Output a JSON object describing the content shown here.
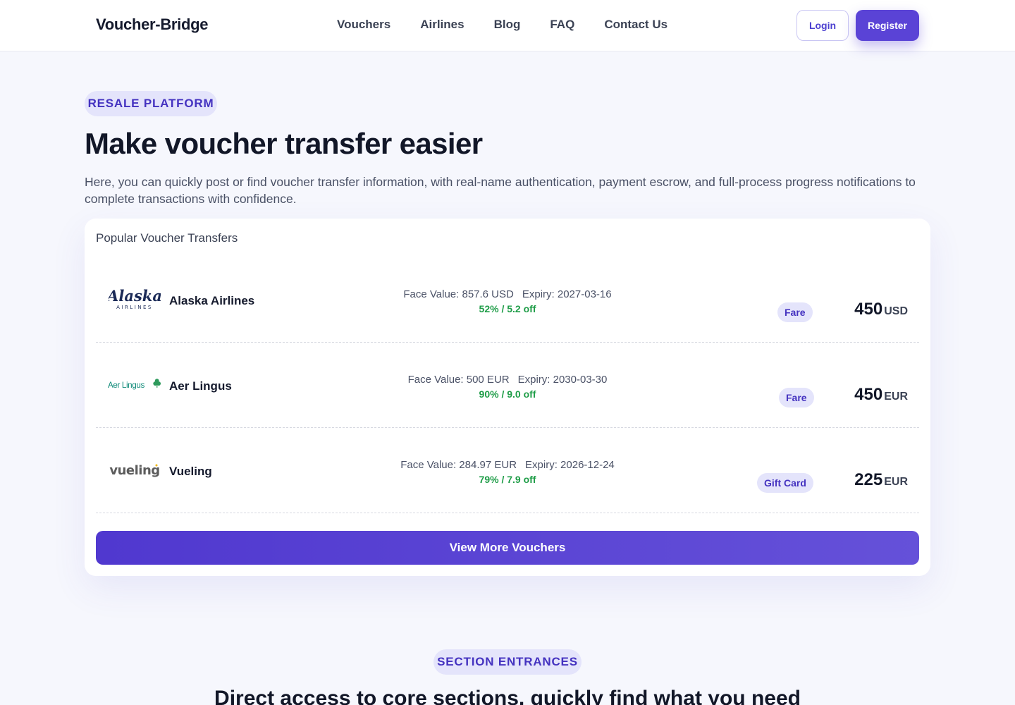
{
  "header": {
    "brand": "Voucher-Bridge",
    "nav": [
      "Vouchers",
      "Airlines",
      "Blog",
      "FAQ",
      "Contact Us"
    ],
    "login_label": "Login",
    "register_label": "Register"
  },
  "hero": {
    "pill": "RESALE PLATFORM",
    "title": "Make voucher transfer easier",
    "description": "Here, you can quickly post or find voucher transfer information, with real-name authentication, payment escrow, and full-process progress notifications to complete transactions with confidence."
  },
  "popular": {
    "title": "Popular Voucher Transfers",
    "rows": [
      {
        "airline": "Alaska Airlines",
        "logo_text": "Alaska",
        "logo_sub": "AIRLINES",
        "face_value": "Face Value: 857.6 USD",
        "expiry": "Expiry: 2027-03-16",
        "discount": "52% / 5.2 off",
        "badge": "Fare",
        "price": "450",
        "currency": "USD"
      },
      {
        "airline": "Aer Lingus",
        "logo_text": "Aer Lingus",
        "face_value": "Face Value: 500 EUR",
        "expiry": "Expiry: 2030-03-30",
        "discount": "90% / 9.0 off",
        "badge": "Fare",
        "price": "450",
        "currency": "EUR"
      },
      {
        "airline": "Vueling",
        "logo_text": "vueling",
        "face_value": "Face Value: 284.97 EUR",
        "expiry": "Expiry: 2026-12-24",
        "discount": "79% / 7.9 off",
        "badge": "Gift Card",
        "price": "225",
        "currency": "EUR"
      }
    ],
    "view_more_label": "View More Vouchers"
  },
  "sections": {
    "pill": "SECTION ENTRANCES",
    "title": "Direct access to core sections, quickly find what you need"
  },
  "colors": {
    "accent": "#5a43d6",
    "badge_bg": "#e4e4fb",
    "discount_green": "#1f9d48",
    "page_bg": "#f6f7fd"
  }
}
